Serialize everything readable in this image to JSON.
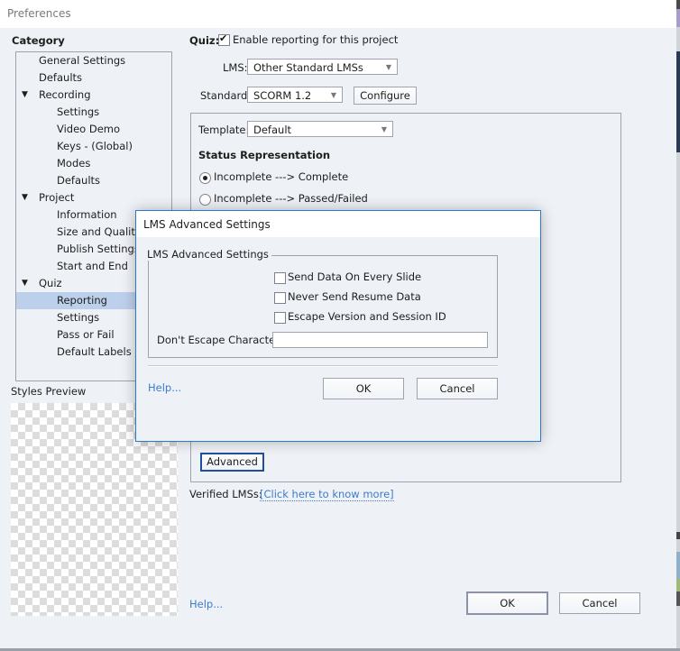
{
  "window": {
    "title": "Preferences"
  },
  "category": {
    "heading": "Category",
    "items": [
      {
        "label": "General Settings",
        "level": 1,
        "expandable": false
      },
      {
        "label": "Defaults",
        "level": 1,
        "expandable": false
      },
      {
        "label": "Recording",
        "level": 1,
        "expandable": true,
        "expanded": true
      },
      {
        "label": "Settings",
        "level": 2
      },
      {
        "label": "Video Demo",
        "level": 2
      },
      {
        "label": "Keys - (Global)",
        "level": 2
      },
      {
        "label": "Modes",
        "level": 2
      },
      {
        "label": "Defaults",
        "level": 2
      },
      {
        "label": "Project",
        "level": 1,
        "expandable": true,
        "expanded": true
      },
      {
        "label": "Information",
        "level": 2
      },
      {
        "label": "Size and Quality",
        "level": 2
      },
      {
        "label": "Publish Settings",
        "level": 2
      },
      {
        "label": "Start and End",
        "level": 2
      },
      {
        "label": "Quiz",
        "level": 1,
        "expandable": true,
        "expanded": true
      },
      {
        "label": "Reporting",
        "level": 2,
        "selected": true
      },
      {
        "label": "Settings",
        "level": 2
      },
      {
        "label": "Pass or Fail",
        "level": 2
      },
      {
        "label": "Default Labels",
        "level": 2
      }
    ],
    "expand_icon": "triangle-down-icon"
  },
  "styles_preview": {
    "label": "Styles Preview"
  },
  "reporting": {
    "quiz_label": "Quiz:",
    "enable_label": "Enable reporting for this project",
    "enable_checked": true,
    "lms_label": "LMS:",
    "lms_value": "Other Standard LMSs",
    "standard_label": "Standard:",
    "standard_value": "SCORM 1.2",
    "configure_label": "Configure",
    "template_label": "Template:",
    "template_value": "Default",
    "status_heading": "Status Representation",
    "status_options": [
      {
        "label": "Incomplete ---> Complete",
        "selected": true
      },
      {
        "label": "Incomplete ---> Passed/Failed",
        "selected": false
      }
    ],
    "advanced_label": "Advanced",
    "verified_label": "Verified LMSs:",
    "verified_link": "[Click here to know more]"
  },
  "footer": {
    "help_label": "Help...",
    "ok_label": "OK",
    "cancel_label": "Cancel"
  },
  "dialog": {
    "title": "LMS Advanced Settings",
    "group_label": "LMS Advanced Settings",
    "options": [
      {
        "label": "Send Data On Every Slide",
        "checked": false
      },
      {
        "label": "Never Send Resume Data",
        "checked": false
      },
      {
        "label": "Escape Version and Session ID",
        "checked": false
      }
    ],
    "escape_label": "Don't Escape Characters:",
    "escape_value": "",
    "help_label": "Help...",
    "ok_label": "OK",
    "cancel_label": "Cancel"
  },
  "colors": {
    "selection": "#bcd0ec",
    "link": "#3d7cc9",
    "dialog_border": "#2a7ac9",
    "background": "#eef1f6"
  }
}
